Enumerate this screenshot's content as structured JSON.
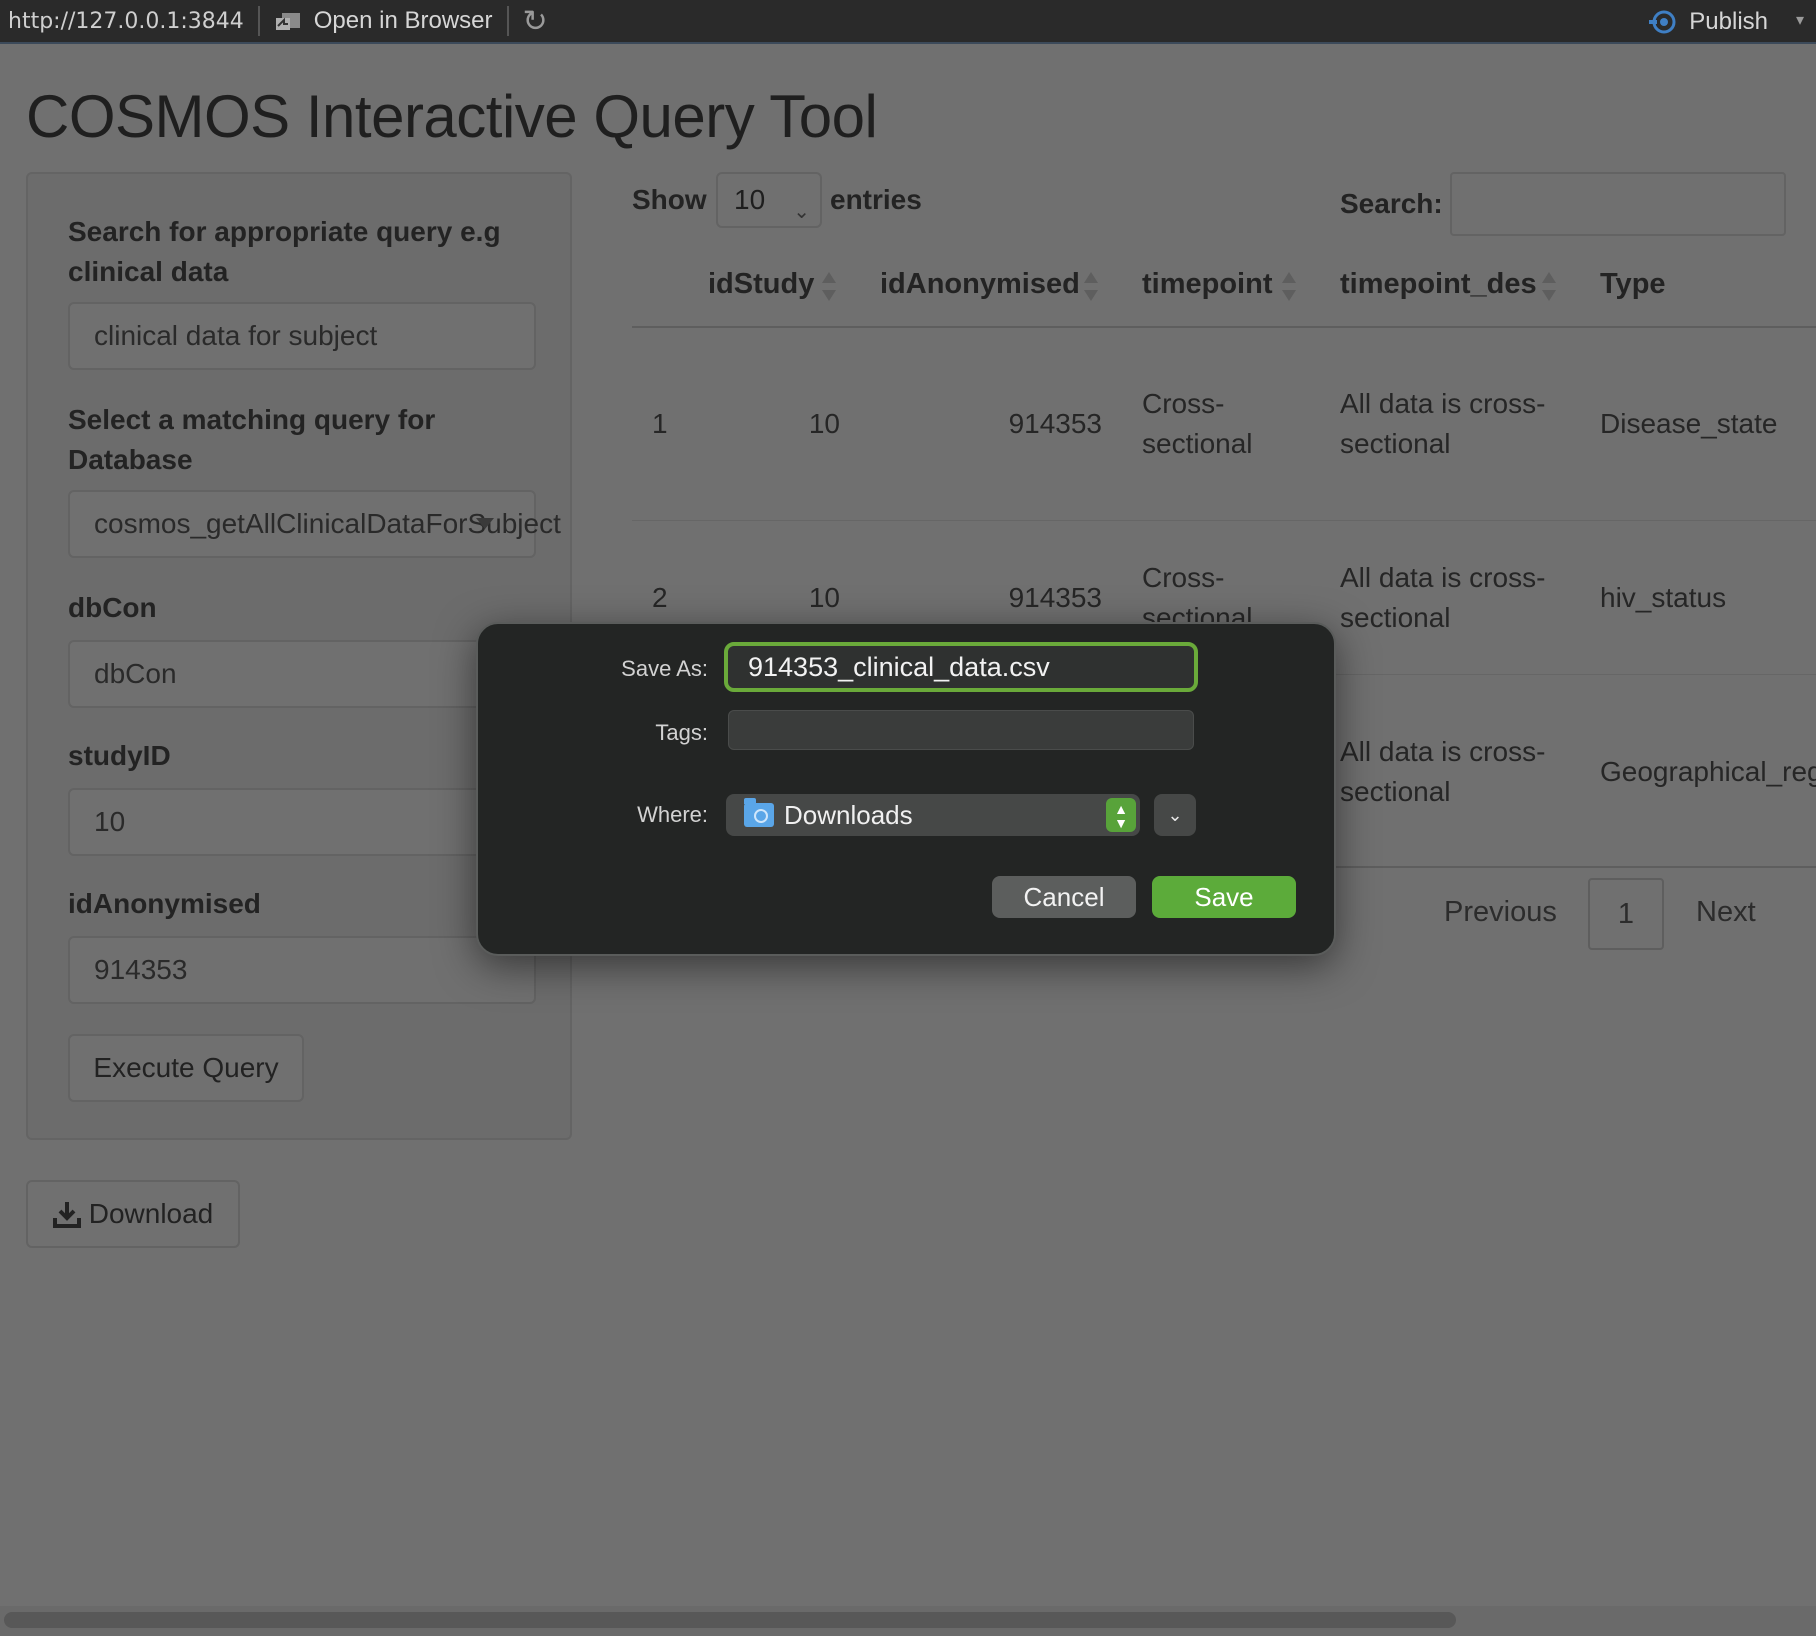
{
  "topbar": {
    "url": "http://127.0.0.1:3844",
    "open_in_browser": "Open in Browser",
    "publish": "Publish"
  },
  "page": {
    "title": "COSMOS Interactive Query Tool"
  },
  "sidebar": {
    "search_label": "Search for appropriate query e.g clinical data",
    "search_value": "clinical data for subject",
    "select_label": "Select a matching query for Database",
    "select_value": "cosmos_getAllClinicalDataForSubject",
    "dbcon_label": "dbCon",
    "dbcon_value": "dbCon",
    "studyid_label": "studyID",
    "studyid_value": "10",
    "idanon_label": "idAnonymised",
    "idanon_value": "914353",
    "execute_label": "Execute Query",
    "download_label": "Download"
  },
  "table": {
    "show_label": "Show",
    "entries_value": "10",
    "entries_label": "entries",
    "search_label": "Search:",
    "columns": [
      "idStudy",
      "idAnonymised",
      "timepoint",
      "timepoint_des",
      "Type"
    ],
    "rows": [
      {
        "index": "1",
        "idStudy": "10",
        "idAnonymised": "914353",
        "timepoint": "Cross-\nsectional",
        "timepoint_des": "All data is cross-\nsectional",
        "type": "Disease_state"
      },
      {
        "index": "2",
        "idStudy": "10",
        "idAnonymised": "914353",
        "timepoint": "Cross-\nsectional",
        "timepoint_des": "All data is cross-\nsectional",
        "type": "hiv_status"
      },
      {
        "timepoint_des": "All data is cross-\nsectional",
        "type": "Geographical_reg"
      }
    ],
    "pager": {
      "previous": "Previous",
      "page": "1",
      "next": "Next"
    }
  },
  "dialog": {
    "save_as_label": "Save As:",
    "filename": "914353_clinical_data.csv",
    "tags_label": "Tags:",
    "where_label": "Where:",
    "where_value": "Downloads",
    "cancel": "Cancel",
    "save": "Save"
  }
}
